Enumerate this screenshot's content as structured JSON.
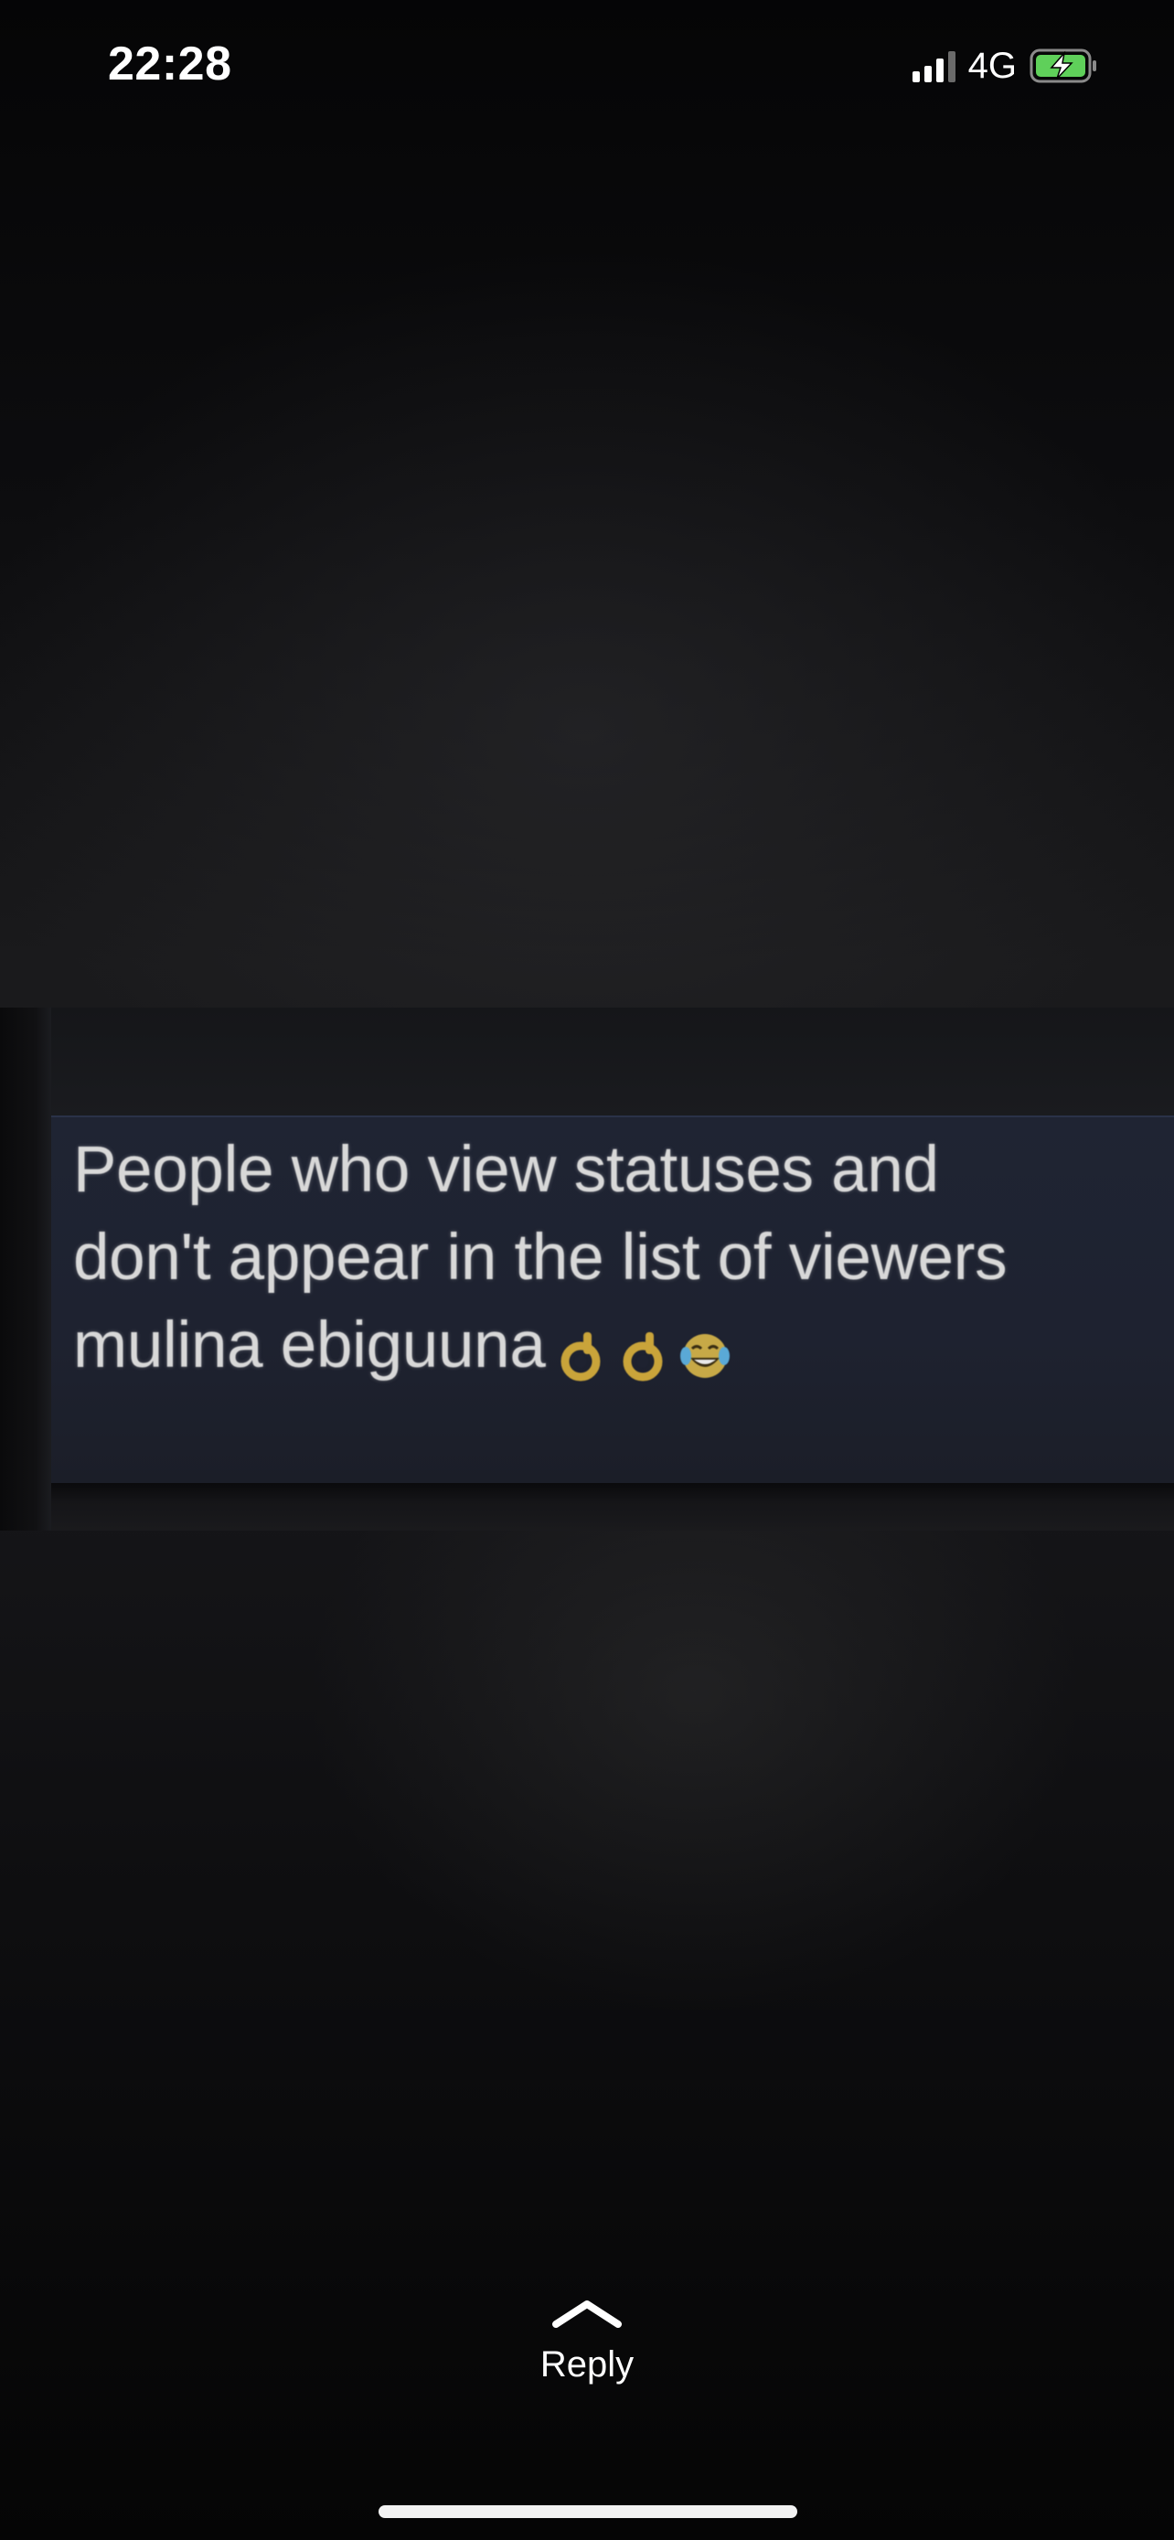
{
  "status_bar": {
    "time": "22:28",
    "network": "4G",
    "signal_bars": 3,
    "signal_bars_total": 4,
    "battery_state": "charging",
    "battery_color": "#5fd05a"
  },
  "status_post": {
    "caption_lines": [
      "People who view statuses and",
      "don't appear in the list of viewers",
      "mulina ebiguuna"
    ],
    "emojis": [
      "ok-hand-icon",
      "ok-hand-icon",
      "tears-of-joy-icon"
    ]
  },
  "reply": {
    "label": "Reply",
    "icon": "chevron-up-icon"
  }
}
